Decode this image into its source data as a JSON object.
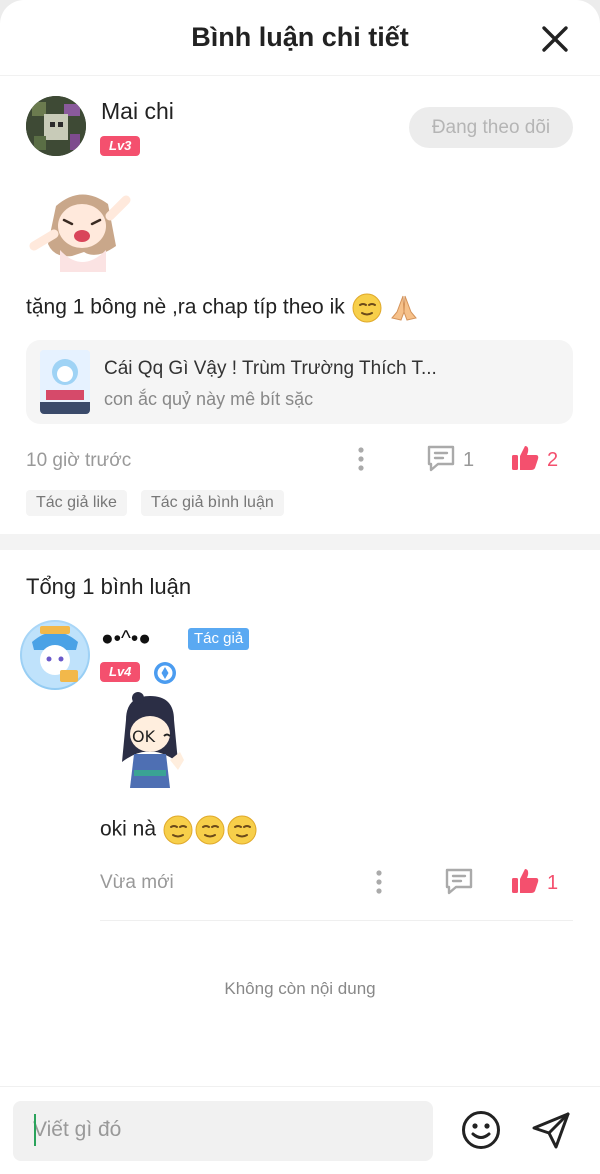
{
  "header": {
    "title": "Bình luận chi tiết"
  },
  "post": {
    "username": "Mai chi",
    "level": "Lv3",
    "follow_label": "Đang theo dõi",
    "text": "tặng 1 bông nè ,ra chap típ theo ik",
    "story": {
      "title": "Cái Qq Gì Vậy ! Trùm Trường Thích T...",
      "subtitle": "con ắc quỷ này mê bít sặc"
    },
    "time": "10 giờ trước",
    "comment_count": "1",
    "like_count": "2",
    "tags": [
      "Tác giả like",
      "Tác giả bình luận"
    ]
  },
  "comments": {
    "total_label": "Tổng 1 bình luận",
    "items": [
      {
        "name": "●•^•●",
        "author_badge": "Tác giả",
        "level": "Lv4",
        "text": "oki nà",
        "time": "Vừa mới",
        "like_count": "1"
      }
    ],
    "end_label": "Không còn nội dung"
  },
  "composer": {
    "placeholder": "Viết gì đó"
  },
  "colors": {
    "accent_red": "#f4506e",
    "author_blue": "#5aa9f2",
    "muted": "#999999"
  },
  "icons": {
    "close": "close-icon",
    "more": "more-vertical-icon",
    "comment": "comment-icon",
    "like": "thumbs-up-icon",
    "emoji": "smiley-icon",
    "send": "send-icon"
  }
}
